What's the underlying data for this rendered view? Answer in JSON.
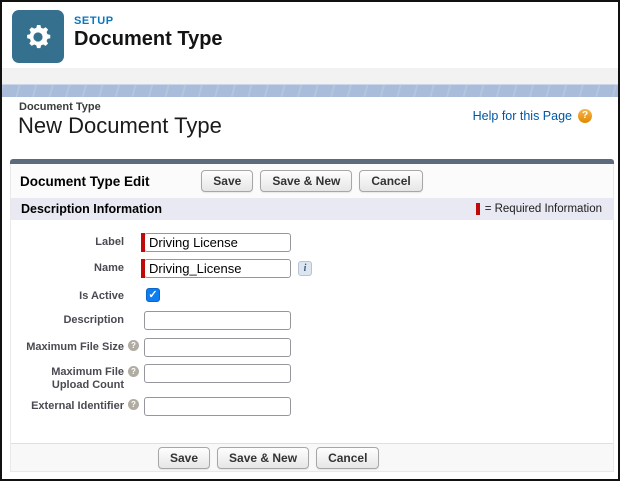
{
  "app_header": {
    "eyebrow": "SETUP",
    "title": "Document Type",
    "icon": "gear-icon"
  },
  "page_header": {
    "breadcrumb": "Document Type",
    "title": "New Document Type",
    "help_link": "Help for this Page",
    "help_icon": "question-mark-icon"
  },
  "block": {
    "title": "Document Type Edit",
    "buttons": [
      "Save",
      "Save & New",
      "Cancel"
    ],
    "section_title": "Description Information",
    "required_legend": "= Required Information"
  },
  "form": {
    "fields": [
      {
        "label": "Label",
        "value": "Driving License",
        "required": true,
        "type": "text"
      },
      {
        "label": "Name",
        "value": "Driving_License",
        "required": true,
        "type": "text",
        "has_info_icon": true
      },
      {
        "label": "Is Active",
        "checked": true,
        "type": "checkbox"
      },
      {
        "label": "Description",
        "value": "",
        "type": "text"
      },
      {
        "label": "Maximum File Size",
        "value": "",
        "type": "text",
        "has_help_icon": true
      },
      {
        "label": "Maximum File Upload Count",
        "label_line1": "Maximum File",
        "label_line2": "Upload Count",
        "value": "",
        "type": "text",
        "has_help_icon": true
      },
      {
        "label": "External Identifier",
        "value": "",
        "type": "text",
        "has_help_icon": true
      }
    ]
  },
  "glyphs": {
    "help": "?",
    "info": "i",
    "check": "✓"
  },
  "colors": {
    "setup_blue": "#0b76bd",
    "gear_tile": "#35708f",
    "banner_blue": "#a9bcd9",
    "block_bar": "#5c6b7c",
    "section_bar": "#e8e9f3",
    "required_red": "#c00a0a",
    "checkbox_blue": "#0d7df2",
    "help_orange": "#e99217",
    "link_blue": "#0157a7"
  }
}
